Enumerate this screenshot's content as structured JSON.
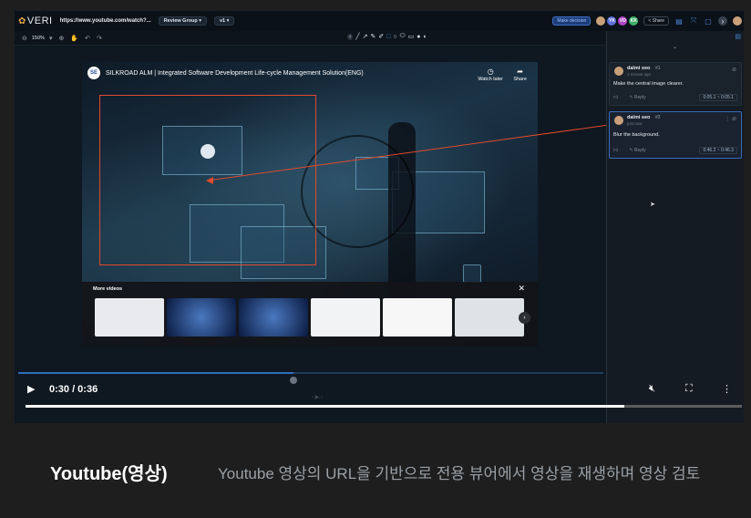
{
  "app": {
    "logo_text": "VERI",
    "url": "https://www.youtube.com/watch?...",
    "review_group": "Review Group",
    "version": "v1",
    "make_decision": "Make decision",
    "share": "Share",
    "zoom": "150%"
  },
  "avatars": [
    {
      "initials": "",
      "color": "#c9a07a"
    },
    {
      "initials": "YK",
      "color": "#5b6fd6"
    },
    {
      "initials": "VD",
      "color": "#b045c8"
    },
    {
      "initials": "KK",
      "color": "#3fae6a"
    }
  ],
  "video": {
    "title": "SILKROAD ALM | Integrated Software Development Life-cycle Management Solution(ENG)",
    "logo": "SE",
    "watch_later": "Watch later",
    "share": "Share",
    "more_videos": "More videos"
  },
  "comments": [
    {
      "author": "dalmi seo",
      "num": "#1",
      "time": "1 minute ago",
      "text": "Make the central image clearer.",
      "reply": "Reply",
      "range": "0:05.1 ~ 0:05.1"
    },
    {
      "author": "dalmi seo",
      "num": "#2",
      "time": "just now",
      "text": "Blur the background.",
      "reply": "Reply",
      "range": "0:46.2 ~ 0:46.3"
    }
  ],
  "player": {
    "time": "0:30 / 0:36",
    "progress": 0.836,
    "scrub_progress": 0.47
  },
  "caption": {
    "title": "Youtube(영상)",
    "description": "Youtube 영상의 URL을 기반으로 전용 뷰어에서 영상을 재생하며 영상 검토"
  }
}
